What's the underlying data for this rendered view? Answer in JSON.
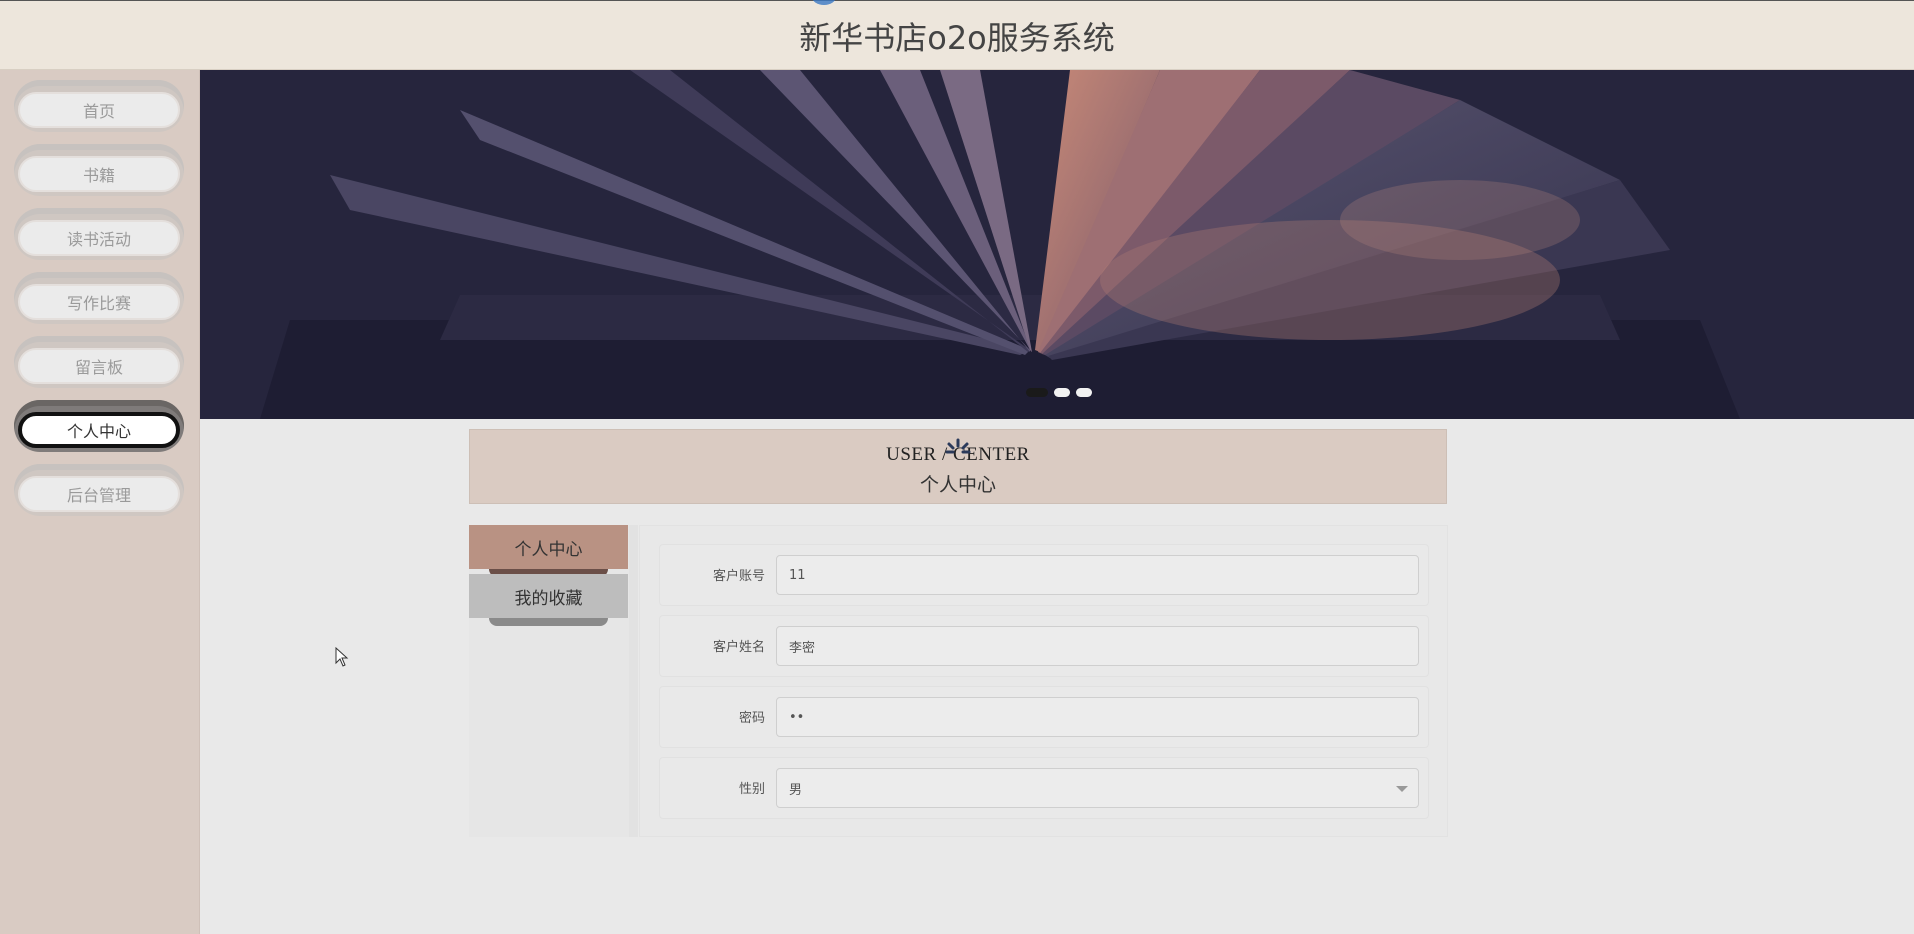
{
  "header": {
    "title": "新华书店o2o服务系统"
  },
  "sidebar": {
    "items": [
      {
        "label": "首页",
        "active": false
      },
      {
        "label": "书籍",
        "active": false
      },
      {
        "label": "读书活动",
        "active": false
      },
      {
        "label": "写作比赛",
        "active": false
      },
      {
        "label": "留言板",
        "active": false
      },
      {
        "label": "个人中心",
        "active": true
      },
      {
        "label": "后台管理",
        "active": false
      }
    ]
  },
  "banner": {
    "slides": 3,
    "active_slide": 1
  },
  "section": {
    "title_en": "USER / CENTER",
    "title_cn": "个人中心"
  },
  "tabs": [
    {
      "label": "个人中心",
      "active": true
    },
    {
      "label": "我的收藏",
      "active": false
    }
  ],
  "form": {
    "account": {
      "label": "客户账号",
      "value": "11"
    },
    "name": {
      "label": "客户姓名",
      "value": "李密"
    },
    "password": {
      "label": "密码",
      "value": "••"
    },
    "gender": {
      "label": "性别",
      "value": "男"
    }
  },
  "colors": {
    "header_bg": "#ede6dc",
    "sidebar_bg": "#d9cbc3",
    "section_bg": "#dacbc2",
    "tab_active": "#b99283",
    "tab_inactive": "#bdbdbd"
  }
}
